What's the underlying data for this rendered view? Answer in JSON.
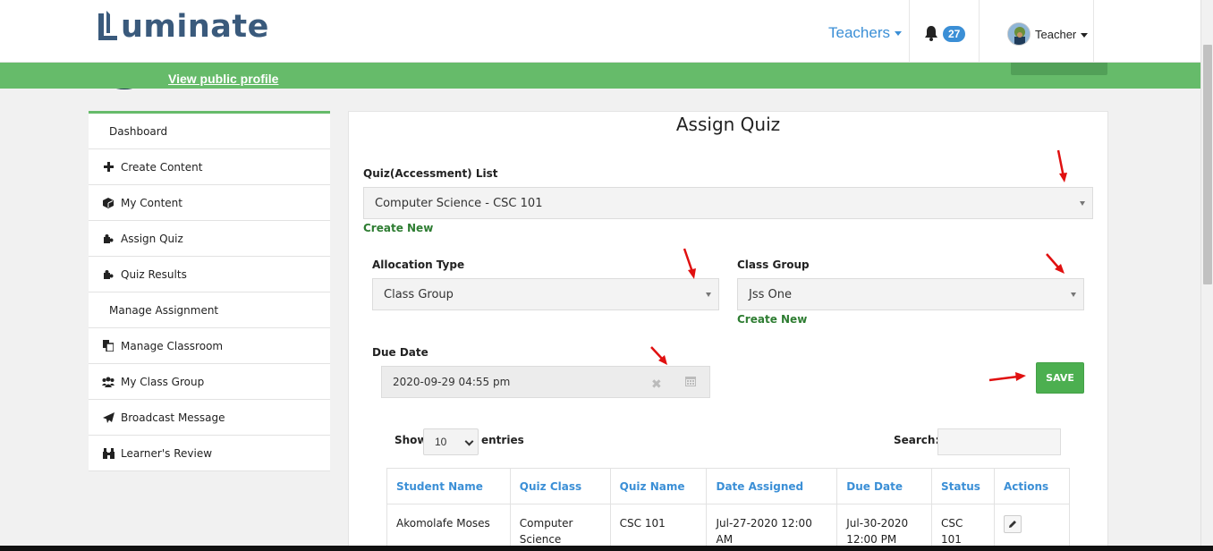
{
  "header": {
    "logo_text": "uminate",
    "nav_teachers": "Teachers",
    "notification_count": "27",
    "user_label": "Teacher"
  },
  "banner": {
    "view_profile": "View public profile"
  },
  "sidebar": {
    "items": [
      {
        "label": "Dashboard",
        "icon": "none"
      },
      {
        "label": "Create Content",
        "icon": "plus-icon"
      },
      {
        "label": "My Content",
        "icon": "cube-icon"
      },
      {
        "label": "Assign Quiz",
        "icon": "puzzle-icon"
      },
      {
        "label": "Quiz Results",
        "icon": "puzzle-icon"
      },
      {
        "label": "Manage Assignment",
        "icon": "none"
      },
      {
        "label": "Manage Classroom",
        "icon": "copy-icon"
      },
      {
        "label": "My Class Group",
        "icon": "users-icon"
      },
      {
        "label": "Broadcast Message",
        "icon": "paper-plane-icon"
      },
      {
        "label": "Learner's Review",
        "icon": "binoculars-icon"
      }
    ]
  },
  "main": {
    "title": "Assign Quiz",
    "quiz_list_label": "Quiz(Accessment) List",
    "quiz_list_value": "Computer Science - CSC 101",
    "create_new_quiz": "Create New",
    "allocation_label": "Allocation Type",
    "allocation_value": "Class Group",
    "class_group_label": "Class Group",
    "class_group_value": "Jss One",
    "create_new_group": "Create New",
    "due_date_label": "Due Date",
    "due_date_value": "2020-09-29 04:55 pm",
    "save_label": "SAVE"
  },
  "table": {
    "show_label": "Show",
    "entries_value": "10",
    "entries_label": "entries",
    "search_label": "Search:",
    "columns": [
      "Student Name",
      "Quiz Class",
      "Quiz Name",
      "Date Assigned",
      "Due Date",
      "Status",
      "Actions"
    ],
    "rows": [
      {
        "student": "Akomolafe Moses",
        "quiz_class": "Computer Science",
        "quiz_name": "CSC 101",
        "date_assigned": "Jul-27-2020 12:00 AM",
        "due_date": "Jul-30-2020 12:00 PM",
        "status": "CSC 101"
      }
    ]
  },
  "colors": {
    "brand_green": "#66bb6a",
    "link_blue": "#3b8fd6",
    "logo_navy": "#3a5a7c",
    "annotation_red": "#e01010"
  }
}
